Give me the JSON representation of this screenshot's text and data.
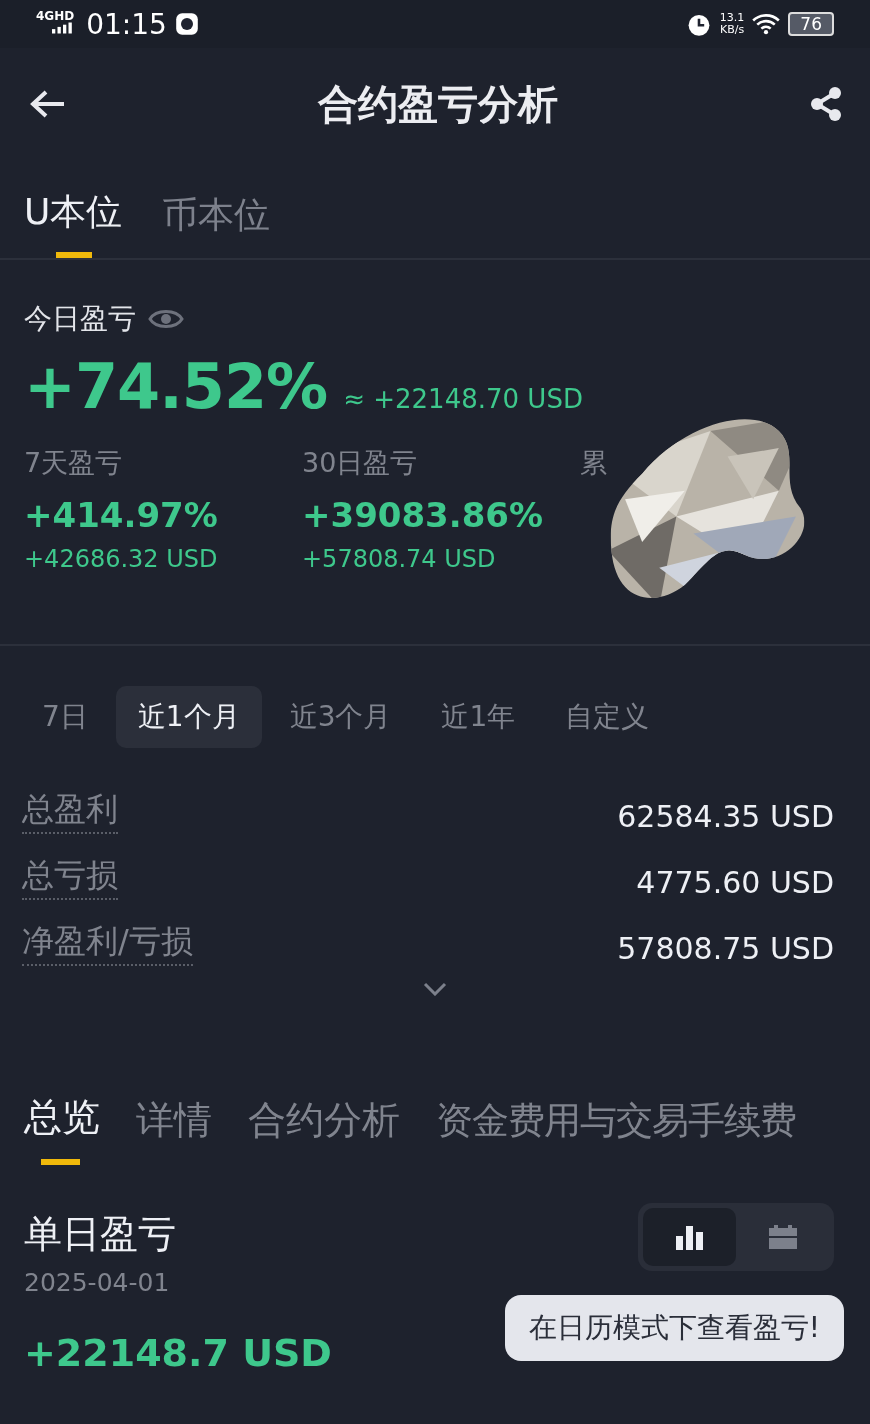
{
  "status_bar": {
    "network": "4GHD",
    "time": "01:15",
    "speed_value": "13.1",
    "speed_unit": "KB/s",
    "battery": "76"
  },
  "header": {
    "title": "合约盈亏分析"
  },
  "tabs": [
    {
      "label": "U本位",
      "selected": true
    },
    {
      "label": "币本位",
      "selected": false
    }
  ],
  "today": {
    "label": "今日盈亏",
    "percent": "+74.52%",
    "approx": "≈ +22148.70 USD"
  },
  "stats": [
    {
      "label": "7天盈亏",
      "percent": "+414.97%",
      "usd": "+42686.32 USD"
    },
    {
      "label": "30日盈亏",
      "percent": "+39083.86%",
      "usd": "+57808.74 USD"
    },
    {
      "label": "累"
    }
  ],
  "periods": [
    {
      "label": "7日",
      "selected": false
    },
    {
      "label": "近1个月",
      "selected": true
    },
    {
      "label": "近3个月",
      "selected": false
    },
    {
      "label": "近1年",
      "selected": false
    },
    {
      "label": "自定义",
      "selected": false
    }
  ],
  "summary": [
    {
      "label": "总盈利",
      "value": "62584.35 USD"
    },
    {
      "label": "总亏损",
      "value": "4775.60 USD"
    },
    {
      "label": "净盈利/亏损",
      "value": "57808.75 USD"
    }
  ],
  "section_tabs": [
    {
      "label": "总览",
      "selected": true
    },
    {
      "label": "详情",
      "selected": false
    },
    {
      "label": "合约分析",
      "selected": false
    },
    {
      "label": "资金费用与交易手续费",
      "selected": false
    }
  ],
  "daily": {
    "title": "单日盈亏",
    "date": "2025-04-01",
    "value": "+22148.7 USD"
  },
  "view_toggle": [
    {
      "kind": "bar-chart",
      "selected": true
    },
    {
      "kind": "calendar",
      "selected": false
    }
  ],
  "tooltip": "在日历模式下查看盈亏!"
}
